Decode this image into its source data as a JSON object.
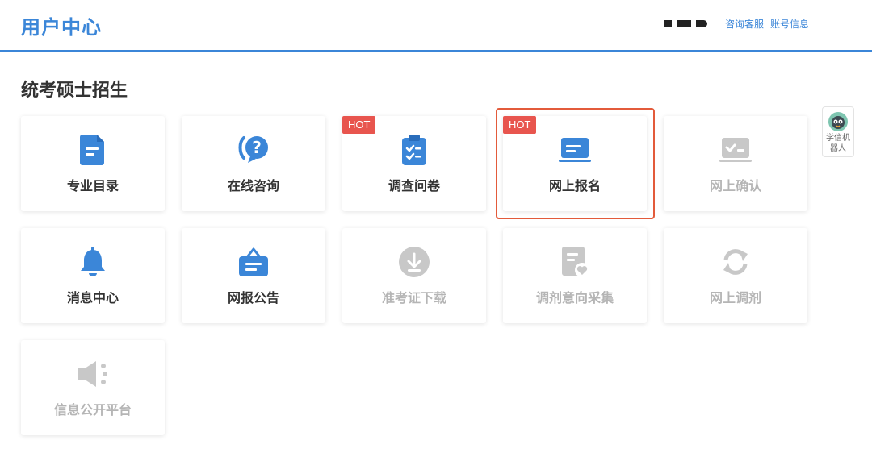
{
  "header": {
    "title": "用户中心",
    "links": [
      {
        "label": "咨询客服"
      },
      {
        "label": "账号信息"
      }
    ]
  },
  "section": {
    "title": "统考硕士招生"
  },
  "cards": [
    {
      "label": "专业目录",
      "icon": "document-icon",
      "enabled": true,
      "hot": false
    },
    {
      "label": "在线咨询",
      "icon": "question-chat-icon",
      "enabled": true,
      "hot": false
    },
    {
      "label": "调查问卷",
      "icon": "clipboard-checklist-icon",
      "enabled": true,
      "hot": true
    },
    {
      "label": "网上报名",
      "icon": "laptop-form-icon",
      "enabled": true,
      "hot": true
    },
    {
      "label": "网上确认",
      "icon": "laptop-check-icon",
      "enabled": false,
      "hot": false
    },
    {
      "label": "消息中心",
      "icon": "bell-icon",
      "enabled": true,
      "hot": false
    },
    {
      "label": "网报公告",
      "icon": "notice-board-icon",
      "enabled": true,
      "hot": false
    },
    {
      "label": "准考证下载",
      "icon": "download-icon",
      "enabled": false,
      "hot": false
    },
    {
      "label": "调剂意向采集",
      "icon": "document-heart-icon",
      "enabled": false,
      "hot": false
    },
    {
      "label": "网上调剂",
      "icon": "refresh-icon",
      "enabled": false,
      "hot": false
    },
    {
      "label": "信息公开平台",
      "icon": "speaker-icon",
      "enabled": false,
      "hot": false
    }
  ],
  "badge": {
    "hot_label": "HOT"
  },
  "robot": {
    "label": "学信机器人"
  },
  "colors": {
    "accent": "#3b86d8",
    "hot": "#e8554e",
    "highlight": "#e35b3b",
    "disabled": "#c8c8c8"
  }
}
